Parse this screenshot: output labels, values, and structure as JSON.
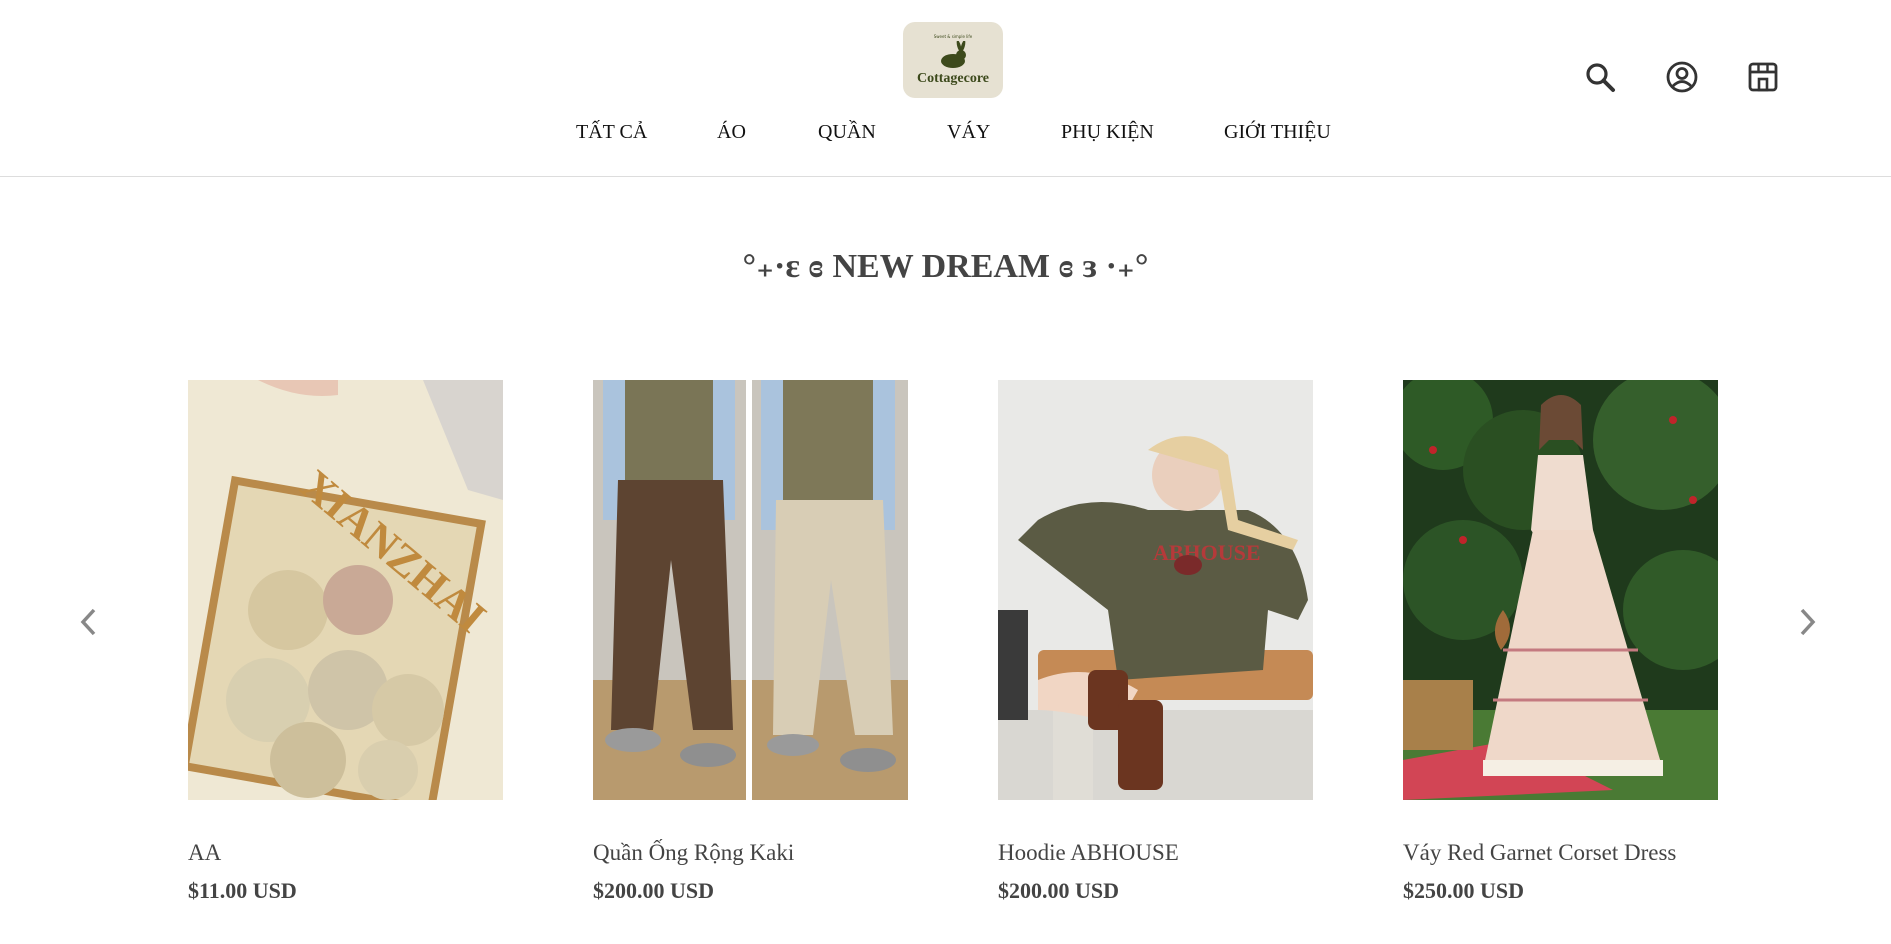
{
  "header": {
    "logo": {
      "tagline": "Sweet & simple life",
      "name": "Cottagecore"
    },
    "nav": [
      {
        "label": "TẤT CẢ"
      },
      {
        "label": "ÁO"
      },
      {
        "label": "QUẦN"
      },
      {
        "label": "VÁY"
      },
      {
        "label": "PHỤ KIỆN"
      },
      {
        "label": "GIỚI THIỆU"
      }
    ],
    "icons": [
      "search-icon",
      "account-icon",
      "store-icon"
    ]
  },
  "section": {
    "title": "°₊·ɛ ɞ NEW DREAM ɞ ɜ ·₊°"
  },
  "products": [
    {
      "title": "AA",
      "price": "$11.00 USD"
    },
    {
      "title": "Quần Ống Rộng Kaki",
      "price": "$200.00 USD"
    },
    {
      "title": "Hoodie ABHOUSE",
      "price": "$200.00 USD"
    },
    {
      "title": "Váy Red Garnet Corset Dress",
      "price": "$250.00 USD"
    }
  ],
  "carousel": {
    "prev_icon": "chevron-left-icon",
    "next_icon": "chevron-right-icon"
  },
  "colors": {
    "text": "#444444",
    "border": "#dddddd",
    "logo_bg": "#e6e1d2",
    "logo_fg": "#3d4a1c"
  }
}
